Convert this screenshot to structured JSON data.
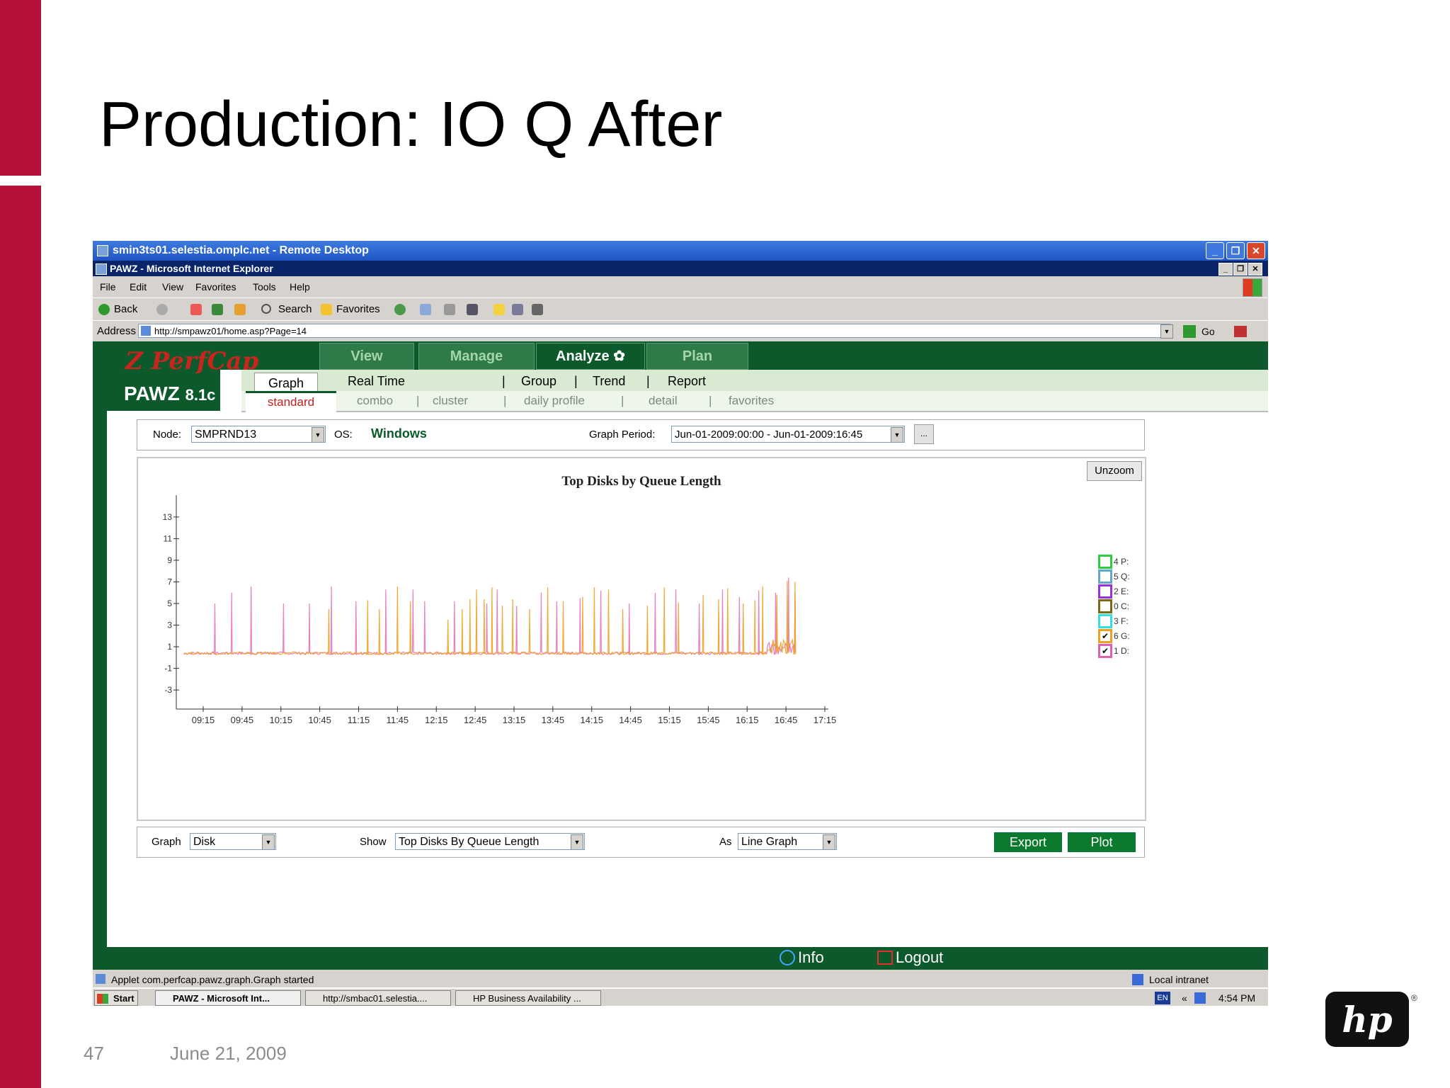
{
  "slide": {
    "title": "Production: IO Q After",
    "page_number": "47",
    "date": "June 21, 2009",
    "logo_text": "hp",
    "logo_reg": "®"
  },
  "rdp": {
    "title": "smin3ts01.selestia.omplc.net - Remote Desktop",
    "buttons": [
      "_",
      "❐",
      "✕"
    ]
  },
  "ie": {
    "title": "PAWZ - Microsoft Internet Explorer",
    "buttons": [
      "_",
      "❐",
      "✕"
    ],
    "menu": [
      "File",
      "Edit",
      "View",
      "Favorites",
      "Tools",
      "Help"
    ],
    "toolbar": {
      "back": "Back",
      "search": "Search",
      "favorites": "Favorites"
    },
    "address_label": "Address",
    "address_value": "http://smpawz01/home.asp?Page=14",
    "go": "Go"
  },
  "app": {
    "logo_perf": "PerfCap",
    "logo_z": "Z",
    "logo_pawz": "PAWZ",
    "logo_version": "8.1c",
    "main_tabs": [
      "View",
      "Manage",
      "Analyze",
      "Plan"
    ],
    "paw_icon": "✿",
    "subnav1": [
      "Graph",
      "Real Time",
      "|",
      "Group",
      "|",
      "Trend",
      "|",
      "Report"
    ],
    "subnav2": [
      "standard",
      "combo",
      "|",
      "cluster",
      "|",
      "daily profile",
      "|",
      "detail",
      "|",
      "favorites"
    ],
    "node_label": "Node:",
    "node_value": "SMPRND13",
    "os_label": "OS:",
    "os_value": "Windows",
    "period_label": "Graph Period:",
    "period_value": "Jun-01-2009:00:00 - Jun-01-2009:16:45",
    "period_more": "...",
    "unzoom": "Unzoom",
    "graph_label": "Graph",
    "graph_value": "Disk",
    "show_label": "Show",
    "show_value": "Top Disks By Queue Length",
    "as_label": "As",
    "as_value": "Line Graph",
    "export": "Export",
    "plot": "Plot",
    "info": "Info",
    "logout": "Logout"
  },
  "status": {
    "text": "Applet com.perfcap.pawz.graph.Graph started",
    "zone": "Local intranet"
  },
  "taskbar": {
    "start": "Start",
    "items": [
      "PAWZ - Microsoft Int...",
      "http://smbac01.selestia....",
      "HP Business Availability ..."
    ],
    "lang": "EN",
    "chevron": "«",
    "time": "4:54 PM"
  },
  "chart_data": {
    "type": "line",
    "title": "Top Disks by Queue Length",
    "xticks": [
      "09:15",
      "09:45",
      "10:15",
      "10:45",
      "11:15",
      "11:45",
      "12:15",
      "12:45",
      "13:15",
      "13:45",
      "14:15",
      "14:45",
      "15:15",
      "15:45",
      "16:15",
      "16:45",
      "17:15"
    ],
    "yticks": [
      "13",
      "11",
      "9",
      "7",
      "5",
      "3",
      "1",
      "-1",
      "-3"
    ],
    "ylim": [
      -3,
      13
    ],
    "legend": [
      {
        "label": "4 P:",
        "color": "#2ecc40",
        "checked": false
      },
      {
        "label": "5 Q:",
        "color": "#5fa8c8",
        "checked": false
      },
      {
        "label": "2 E:",
        "color": "#9b30d9",
        "checked": false
      },
      {
        "label": "0 C:",
        "color": "#7a6a10",
        "checked": false
      },
      {
        "label": "3 F:",
        "color": "#33e0e0",
        "checked": false
      },
      {
        "label": "6 G:",
        "color": "#f0a020",
        "checked": true
      },
      {
        "label": "1 D:",
        "color": "#e060b0",
        "checked": true
      }
    ],
    "series": [
      {
        "name": "1 D:",
        "color": "#e870b8",
        "spikes": [
          [
            "09:24",
            5.0
          ],
          [
            "09:37",
            6.0
          ],
          [
            "09:52",
            6.6
          ],
          [
            "10:17",
            5.0
          ],
          [
            "10:37",
            5.0
          ],
          [
            "10:54",
            6.6
          ],
          [
            "11:13",
            5.2
          ],
          [
            "11:36",
            6.3
          ],
          [
            "11:57",
            6.3
          ],
          [
            "12:06",
            5.2
          ],
          [
            "12:29",
            5.2
          ],
          [
            "12:54",
            5.0
          ],
          [
            "13:02",
            6.3
          ],
          [
            "13:17",
            4.8
          ],
          [
            "13:36",
            6.0
          ],
          [
            "13:48",
            5.2
          ],
          [
            "14:06",
            5.5
          ],
          [
            "14:22",
            6.2
          ],
          [
            "14:44",
            5.0
          ],
          [
            "15:04",
            6.0
          ],
          [
            "15:20",
            6.3
          ],
          [
            "15:38",
            5.0
          ],
          [
            "15:56",
            6.3
          ],
          [
            "16:09",
            5.6
          ],
          [
            "16:24",
            6.2
          ],
          [
            "16:37",
            6.0
          ],
          [
            "16:47",
            7.4
          ],
          [
            "16:52",
            6.0
          ]
        ],
        "baseline": 0.4
      },
      {
        "name": "6 G:",
        "color": "#f0a020",
        "spikes": [
          [
            "10:52",
            4.5
          ],
          [
            "11:22",
            5.3
          ],
          [
            "11:31",
            4.5
          ],
          [
            "11:45",
            6.6
          ],
          [
            "11:55",
            5.2
          ],
          [
            "12:24",
            3.5
          ],
          [
            "12:35",
            4.5
          ],
          [
            "12:41",
            5.4
          ],
          [
            "12:46",
            6.3
          ],
          [
            "12:52",
            5.4
          ],
          [
            "12:58",
            6.5
          ],
          [
            "13:06",
            4.8
          ],
          [
            "13:14",
            5.4
          ],
          [
            "13:27",
            4.5
          ],
          [
            "13:41",
            6.5
          ],
          [
            "13:53",
            5.2
          ],
          [
            "14:08",
            5.6
          ],
          [
            "14:17",
            6.5
          ],
          [
            "14:28",
            6.3
          ],
          [
            "14:39",
            4.5
          ],
          [
            "14:58",
            4.8
          ],
          [
            "15:11",
            6.5
          ],
          [
            "15:22",
            5.1
          ],
          [
            "15:41",
            5.8
          ],
          [
            "15:53",
            5.4
          ],
          [
            "16:00",
            6.4
          ],
          [
            "16:12",
            5.0
          ],
          [
            "16:21",
            5.3
          ],
          [
            "16:27",
            6.6
          ],
          [
            "16:38",
            5.8
          ],
          [
            "16:46",
            7.1
          ],
          [
            "16:52",
            7.0
          ]
        ],
        "baseline": 0.4
      }
    ]
  }
}
